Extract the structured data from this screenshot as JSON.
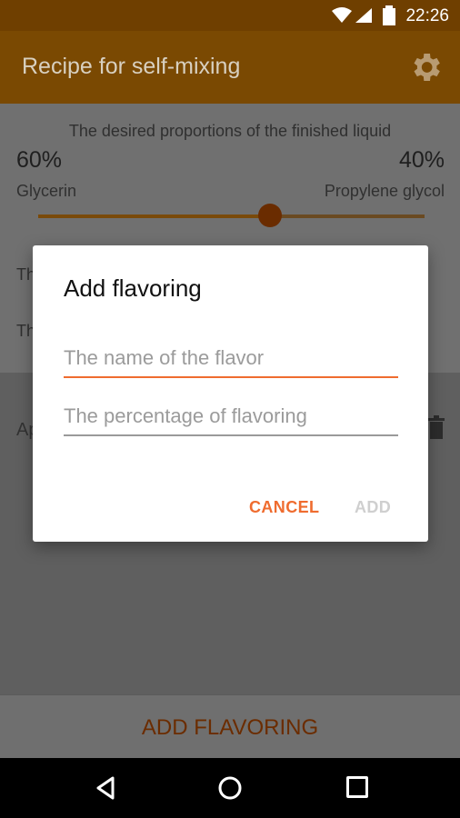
{
  "status": {
    "time": "22:26"
  },
  "app": {
    "title": "Recipe for self-mixing"
  },
  "main": {
    "proportions_label": "The desired proportions of the finished liquid",
    "glycerin_percent": "60%",
    "propylene_percent": "40%",
    "glycerin_label": "Glycerin",
    "propylene_label": "Propylene glycol",
    "slider_value": 0.6,
    "hidden_row1_prefix": "Th",
    "hidden_row2_prefix": "Th",
    "hidden_list_prefix": "Ap"
  },
  "dialog": {
    "title": "Add flavoring",
    "name_placeholder": "The name of the flavor",
    "percentage_placeholder": "The percentage of flavoring",
    "cancel_label": "CANCEL",
    "add_label": "ADD"
  },
  "bottom": {
    "add_flavoring_label": "ADD FLAVORING"
  },
  "colors": {
    "accent": "#ef6c2f",
    "appbar": "#7a4902",
    "dim_overlay_content": "#6d6d6d"
  },
  "icons": {
    "settings": "gear-icon",
    "delete": "trash-icon",
    "wifi": "wifi-icon",
    "signal": "signal-icon",
    "battery": "battery-icon",
    "back": "back-icon",
    "home": "home-icon",
    "recents": "recents-icon"
  }
}
